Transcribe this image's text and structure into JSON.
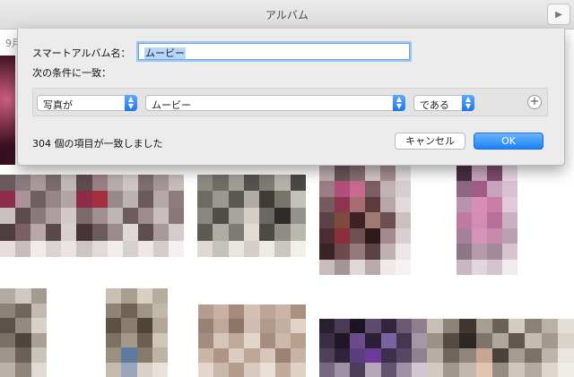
{
  "window": {
    "title": "アルバム"
  },
  "background": {
    "date_label": "9月"
  },
  "dialog": {
    "name_label": "スマートアルバム名：",
    "name_value": "ムービー",
    "match_label": "次の条件に一致：",
    "rule": {
      "field": "写真が",
      "value": "ムービー",
      "operator": "である",
      "add_symbol": "+"
    },
    "result_text": "304 個の項目が一致しました",
    "cancel_label": "キャンセル",
    "ok_label": "OK"
  },
  "colors": {
    "accent": "#1a82fb",
    "sheet_bg": "#ececec"
  },
  "icons": {
    "stepper": "updown-chevron-icon",
    "add": "plus-circle-icon"
  }
}
